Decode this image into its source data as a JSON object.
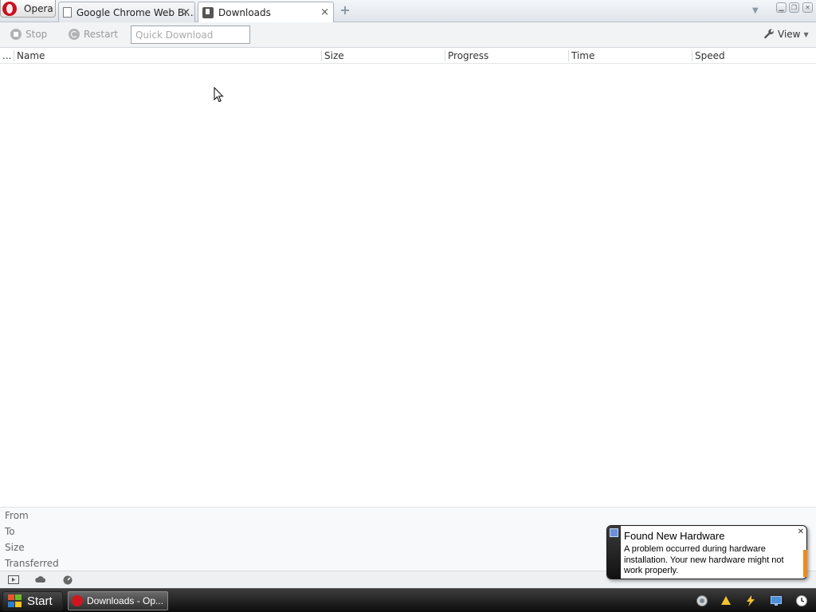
{
  "tabs": {
    "menu_label": "Opera",
    "items": [
      {
        "label": "Google Chrome Web Br...",
        "close": "×"
      },
      {
        "label": "Downloads",
        "close": "×"
      }
    ],
    "new_tab": "+"
  },
  "toolbar": {
    "stop_label": "Stop",
    "restart_label": "Restart",
    "quick_download_placeholder": "Quick Download",
    "view_label": "View"
  },
  "columns": {
    "handle": "...",
    "name": "Name",
    "size": "Size",
    "progress": "Progress",
    "time": "Time",
    "speed": "Speed"
  },
  "downloads": [],
  "details": {
    "from": "From",
    "to": "To",
    "size": "Size",
    "transferred": "Transferred"
  },
  "notification": {
    "title": "Found New Hardware",
    "body": "A problem occurred during hardware installation. Your new hardware might not work properly."
  },
  "taskbar": {
    "start_label": "Start",
    "task_label": "Downloads - Op..."
  },
  "colors": {
    "opera_red": "#c8101e",
    "accent_orange": "#f08a18",
    "taskbar_dark": "#0c0c0c"
  }
}
